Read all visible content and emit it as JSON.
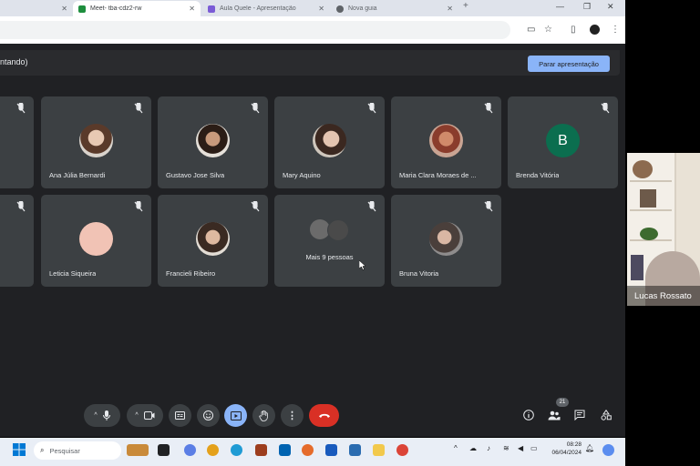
{
  "tabs": [
    {
      "label": "",
      "active": false
    },
    {
      "label": "Meet- tba-cdz2-rw",
      "active": true
    },
    {
      "label": "Aula Quele - Apresentação",
      "active": false
    },
    {
      "label": "Nova guia",
      "active": false
    }
  ],
  "meeting": {
    "presenting_label": "ntando)",
    "stop_presenting_label": "Parar apresentação"
  },
  "participants": [
    {
      "name": "",
      "muted": true
    },
    {
      "name": "Ana Júlia Bernardi",
      "muted": true
    },
    {
      "name": "Gustavo Jose Silva",
      "muted": true
    },
    {
      "name": "Mary Aquino",
      "muted": true
    },
    {
      "name": "Maria Clara Moraes de ...",
      "muted": true
    },
    {
      "name": "Brenda Vitória",
      "muted": true,
      "initial": "B",
      "avatar_color": "#0b6e4f"
    },
    {
      "name": "",
      "muted": true
    },
    {
      "name": "Leticia Siqueira",
      "muted": true
    },
    {
      "name": "Francieli Ribeiro",
      "muted": true
    },
    {
      "name": "Mais 9 pessoas",
      "muted": true
    },
    {
      "name": "Bruna Vitoria",
      "muted": true
    }
  ],
  "participants_count": "21",
  "speaker": {
    "name": "Lucas Rossato"
  },
  "taskbar": {
    "search_placeholder": "Pesquisar",
    "time": "08:28",
    "date": "06/04/2024"
  },
  "colors": {
    "end_call": "#d93025",
    "present_active": "#8ab4f8",
    "tile_bg": "#3c4043"
  }
}
